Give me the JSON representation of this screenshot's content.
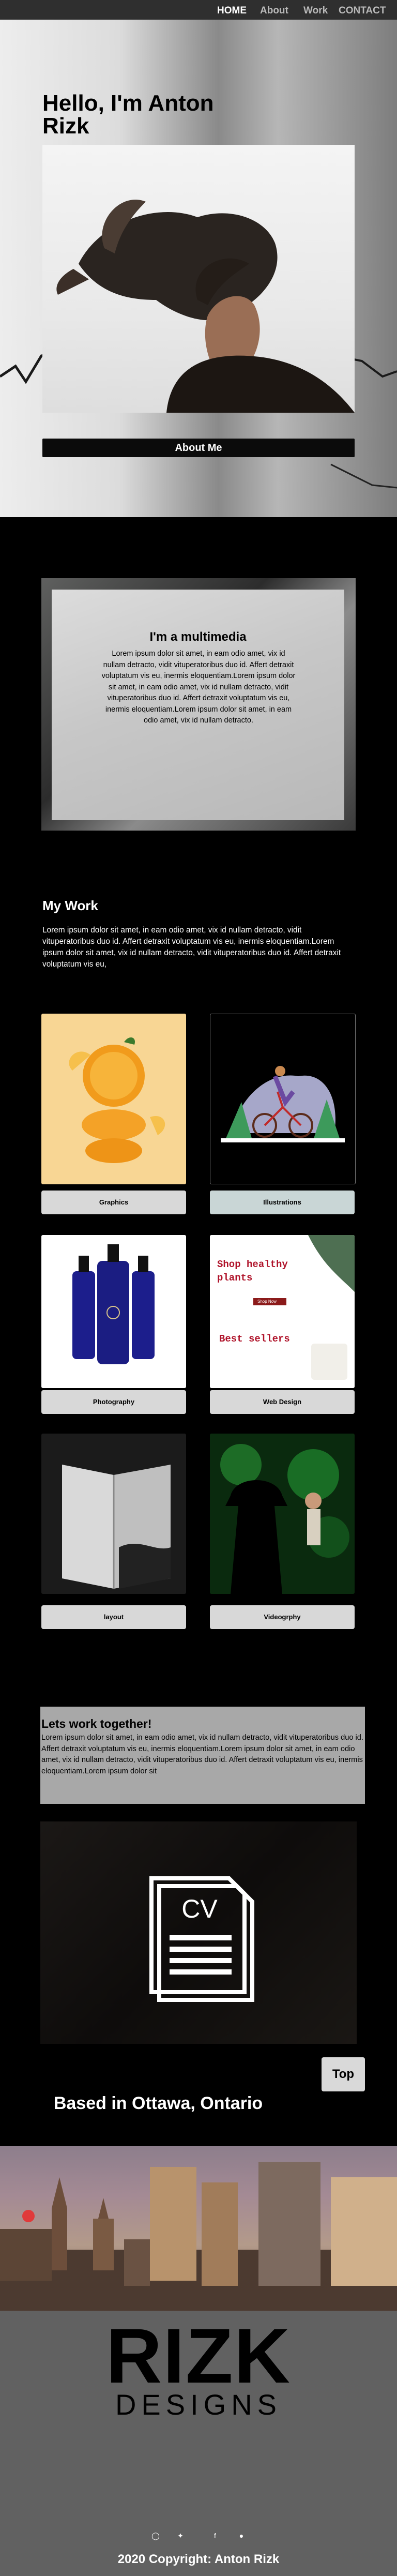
{
  "nav": {
    "items": [
      {
        "label": "HOME",
        "active": true
      },
      {
        "label": "About",
        "active": false
      },
      {
        "label": "Work",
        "active": false
      },
      {
        "label": "CONTACT",
        "active": false
      }
    ]
  },
  "hero": {
    "title": "Hello, I'm Anton Rizk",
    "button_label": "About Me"
  },
  "multimedia": {
    "title": "I'm a multimedia",
    "body": "Lorem ipsum dolor sit amet, in eam odio amet, vix id nullam detracto, vidit vituperatoribus duo id. Affert detraxit voluptatum vis eu, inermis eloquentiam.Lorem ipsum dolor sit amet, in eam odio amet, vix id nullam detracto, vidit vituperatoribus duo id. Affert detraxit voluptatum vis eu, inermis eloquentiam.Lorem ipsum dolor sit amet, in eam odio amet, vix id nullam detracto."
  },
  "work": {
    "title": "My Work",
    "body": "Lorem ipsum dolor sit amet, in eam odio amet, vix id nullam detracto, vidit vituperatoribus duo id. Affert detraxit voluptatum vis eu, inermis eloquentiam.Lorem ipsum dolor sit amet, vix id nullam detracto, vidit vituperatoribus duo id. Affert detraxit voluptatum vis eu,",
    "cards": [
      {
        "label": "Graphics"
      },
      {
        "label": "Illustrations"
      },
      {
        "label": "Photography"
      },
      {
        "label": "Web Design"
      },
      {
        "label": "layout"
      },
      {
        "label": "Videogrphy"
      }
    ],
    "web_mock": {
      "headline_1": "Shop healthy",
      "headline_2": "plants",
      "cta": "Shop Now",
      "best_sellers": "Best sellers"
    }
  },
  "contact": {
    "title": "Lets work together!",
    "body": "Lorem ipsum dolor sit amet, in eam odio amet, vix id nullam detracto, vidit vituperatoribus duo id. Affert detraxit voluptatum vis eu, inermis eloquentiam.Lorem ipsum dolor sit amet, in eam odio amet, vix id nullam detracto, vidit vituperatoribus duo id. Affert detraxit voluptatum vis eu, inermis eloquentiam.Lorem ipsum dolor sit"
  },
  "cv": {
    "icon_text": "CV"
  },
  "top_button": "Top",
  "location": "Based in Ottawa, Ontario",
  "footer": {
    "logo_top": "RIZK",
    "logo_bottom": "DESIGNS",
    "copyright": "2020 Copyright:  Anton Rizk",
    "social": [
      "instagram-icon",
      "twitter-icon",
      "facebook-icon",
      "globe-icon"
    ]
  }
}
